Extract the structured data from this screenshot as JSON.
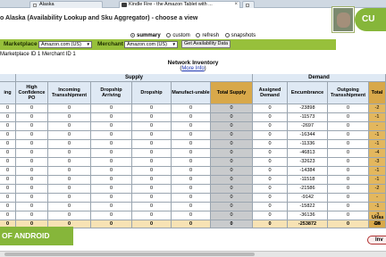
{
  "browser": {
    "tabs": [
      {
        "label": "Alaska",
        "icon": "page-icon",
        "active": false
      },
      {
        "label": "Kindle Fire - the Amazon Tablet with ...",
        "icon": "kindle-icon",
        "active": true
      },
      {
        "label": "",
        "icon": "page-icon",
        "active": false
      }
    ]
  },
  "header": {
    "title": "o Alaska (Availability Lookup and Sku Aggregator) - choose a view",
    "badge": "CU",
    "badge_color": "#86b63a"
  },
  "views": {
    "options": [
      "summary",
      "custom",
      "refresh",
      "snapshots"
    ],
    "selected": "summary"
  },
  "filter": {
    "marketplace_label": "Marketplace",
    "marketplace_value": "Amazon.com (US)",
    "merchant_label": "Merchant",
    "merchant_value": "Amazon.com (US)",
    "button": "Get Availability Data",
    "bar_color": "#97c03b"
  },
  "ids_line": "Marketplace ID 1 Merchant ID 1",
  "inventory": {
    "title": "Network Inventory",
    "more_open": "(",
    "more_link": "More Info",
    "more_close": ")",
    "group_headers": [
      "",
      "Supply",
      "Demand"
    ],
    "columns": [
      "ing",
      "High Confidence PO",
      "Incoming Transshipment",
      "Dropship Arriving",
      "Dropship",
      "Manufact-urable",
      "Total Supply",
      "Assigned Demand",
      "Encumbrance",
      "Outgoing Transshipment",
      "Total"
    ],
    "rows": [
      [
        "0",
        "0",
        "0",
        "0",
        "0",
        "0",
        "0",
        "0",
        "-23898",
        "0",
        "-2"
      ],
      [
        "0",
        "0",
        "0",
        "0",
        "0",
        "0",
        "0",
        "0",
        "-11573",
        "0",
        "-1"
      ],
      [
        "0",
        "0",
        "0",
        "0",
        "0",
        "0",
        "0",
        "0",
        "-2697",
        "0",
        "-"
      ],
      [
        "0",
        "0",
        "0",
        "0",
        "0",
        "0",
        "0",
        "0",
        "-16344",
        "0",
        "-1"
      ],
      [
        "0",
        "0",
        "0",
        "0",
        "0",
        "0",
        "0",
        "0",
        "-11336",
        "0",
        "-1"
      ],
      [
        "0",
        "0",
        "0",
        "0",
        "0",
        "0",
        "0",
        "0",
        "-46813",
        "0",
        "-4"
      ],
      [
        "0",
        "0",
        "0",
        "0",
        "0",
        "0",
        "0",
        "0",
        "-32623",
        "0",
        "-3"
      ],
      [
        "0",
        "0",
        "0",
        "0",
        "0",
        "0",
        "0",
        "0",
        "-14384",
        "0",
        "-1"
      ],
      [
        "0",
        "0",
        "0",
        "0",
        "0",
        "0",
        "0",
        "0",
        "-11518",
        "0",
        "-1"
      ],
      [
        "0",
        "0",
        "0",
        "0",
        "0",
        "0",
        "0",
        "0",
        "-21586",
        "0",
        "-2"
      ],
      [
        "0",
        "0",
        "0",
        "0",
        "0",
        "0",
        "0",
        "0",
        "-9142",
        "0",
        "-"
      ],
      [
        "0",
        "0",
        "0",
        "0",
        "0",
        "0",
        "0",
        "0",
        "-15822",
        "0",
        "-1"
      ],
      [
        "0",
        "0",
        "0",
        "0",
        "0",
        "0",
        "0",
        "0",
        "-36136",
        "0",
        "-3"
      ]
    ],
    "totals": [
      "0",
      "0",
      "0",
      "0",
      "0",
      "0",
      "0",
      "0",
      "-253872",
      "0",
      "-25"
    ],
    "highlight_color": "#d8a84a",
    "gray_color": "#c9cbcd"
  },
  "footer": {
    "android_banner": "OF ANDROID",
    "side_note_line1": "Unas",
    "side_note_line2": "De",
    "inv_button": "Inv"
  }
}
